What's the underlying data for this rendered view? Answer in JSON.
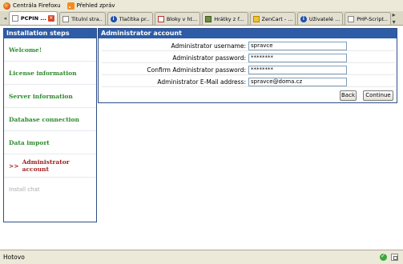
{
  "bookmarks": [
    {
      "label": "Centrála Firefoxu",
      "icon": "firefox-icon"
    },
    {
      "label": "Přehled zpráv",
      "icon": "rss-icon"
    }
  ],
  "tabs": [
    {
      "label": "PCPIN ...",
      "active": true,
      "icon": "page-icon"
    },
    {
      "label": "Titulní stra...",
      "icon": "page-icon"
    },
    {
      "label": "Tlačítka pr...",
      "icon": "info-icon"
    },
    {
      "label": "Bloky v ht...",
      "icon": "pdf-icon"
    },
    {
      "label": "Hrátky z ř...",
      "icon": "image-icon"
    },
    {
      "label": "ZenCart - ...",
      "icon": "zencart-icon"
    },
    {
      "label": "Uživatelé ...",
      "icon": "info-icon"
    },
    {
      "label": "PHP-Script...",
      "icon": "page-icon"
    }
  ],
  "sidebar": {
    "title": "Installation steps",
    "steps": [
      {
        "label": "Welcome!",
        "state": "done"
      },
      {
        "label": "License information",
        "state": "done"
      },
      {
        "label": "Server information",
        "state": "done"
      },
      {
        "label": "Database connection",
        "state": "done"
      },
      {
        "label": "Data import",
        "state": "done"
      },
      {
        "label": "Administrator account",
        "state": "current",
        "prefix": ">>"
      },
      {
        "label": "Install chat",
        "state": "disabled"
      }
    ]
  },
  "panel": {
    "title": "Administrator account",
    "fields": [
      {
        "label": "Administrator username:",
        "value": "spravce"
      },
      {
        "label": "Administrator password:",
        "value": "********"
      },
      {
        "label": "Confirm Administrator password:",
        "value": "********"
      },
      {
        "label": "Administrator E-Mail address:",
        "value": "spravce@doma.cz"
      }
    ],
    "back_label": "Back",
    "continue_label": "Continue"
  },
  "status": {
    "text": "Hotovo"
  },
  "colors": {
    "header_blue": "#2e5ca6",
    "step_done": "#2f8a2f",
    "step_current": "#a12222"
  }
}
